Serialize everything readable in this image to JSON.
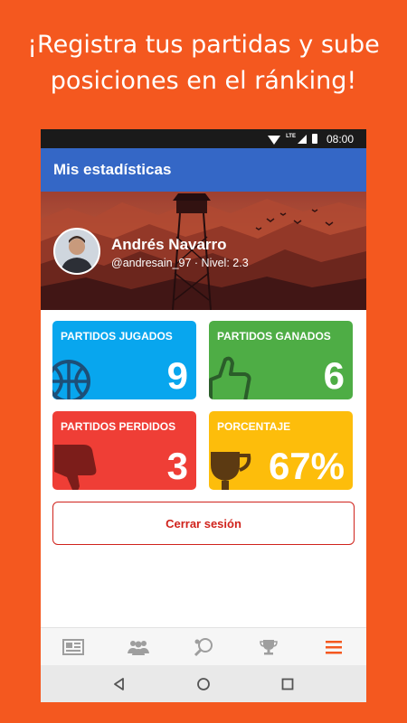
{
  "promo": {
    "line1": "¡Registra tus partidas y sube",
    "line2": "posiciones en el ránking!"
  },
  "status_bar": {
    "network": "LTE",
    "time": "08:00",
    "icons": [
      "wifi-icon",
      "signal-icon",
      "battery-icon"
    ]
  },
  "app_bar": {
    "title": "Mis estadísticas"
  },
  "profile": {
    "name": "Andrés Navarro",
    "meta": "@andresain_97 · Nivel: 2.3"
  },
  "stats": [
    {
      "label": "PARTIDOS JUGADOS",
      "value": "9",
      "color": "#08a6ee",
      "icon": "basketball-icon"
    },
    {
      "label": "PARTIDOS GANADOS",
      "value": "6",
      "color": "#4ead45",
      "icon": "thumbs-up-icon"
    },
    {
      "label": "PARTIDOS PERDIDOS",
      "value": "3",
      "color": "#ef3e36",
      "icon": "thumbs-down-icon"
    },
    {
      "label": "PORCENTAJE",
      "value": "67%",
      "color": "#fdbd0b",
      "icon": "trophy-icon"
    }
  ],
  "logout_label": "Cerrar sesión",
  "bottom_nav": [
    {
      "icon": "news-icon",
      "active": false
    },
    {
      "icon": "group-icon",
      "active": false
    },
    {
      "icon": "racket-icon",
      "active": false
    },
    {
      "icon": "trophy-icon",
      "active": false
    },
    {
      "icon": "menu-icon",
      "active": true
    }
  ],
  "colors": {
    "background": "#f4581f",
    "app_bar": "#3467c6",
    "danger": "#d0231c",
    "nav_active": "#f4581f",
    "nav_inactive": "#9e9e9e"
  }
}
